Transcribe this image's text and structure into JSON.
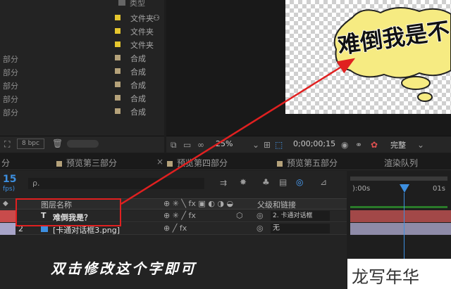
{
  "project_panel": {
    "header_partial": "类型",
    "rows": [
      {
        "name": "",
        "type": "文件夹",
        "color": "#e6c72e"
      },
      {
        "name": "",
        "type": "文件夹",
        "color": "#e6c72e"
      },
      {
        "name": "",
        "type": "文件夹",
        "color": "#e6c72e"
      },
      {
        "name": "部分",
        "type": "合成",
        "color": "#b5a27a"
      },
      {
        "name": "部分",
        "type": "合成",
        "color": "#b5a27a"
      },
      {
        "name": "部分",
        "type": "合成",
        "color": "#b5a27a"
      },
      {
        "name": "部分",
        "type": "合成",
        "color": "#b5a27a"
      },
      {
        "name": "部分",
        "type": "合成",
        "color": "#b5a27a"
      }
    ],
    "bpc_label": "8 bpc"
  },
  "composition": {
    "bubble_text": "难倒我是不",
    "zoom": "25%",
    "timecode": "0;00;00;15",
    "resolution": "完整"
  },
  "tabs": [
    {
      "label": "分",
      "color": ""
    },
    {
      "label": "预览第三部分",
      "color": "#b5a27a"
    },
    {
      "label": "预览第四部分",
      "color": "#b5a27a"
    },
    {
      "label": "预览第五部分",
      "color": "#b5a27a"
    },
    {
      "label": "渲染队列",
      "color": ""
    }
  ],
  "timeline": {
    "frame_counter": "15",
    "frame_sub": "fps)",
    "search_placeholder": "ρ.",
    "col_layer_name": "图层名称",
    "col_parent": "父级和链接",
    "ruler_start": "):00s",
    "ruler_end": "01s",
    "layers": [
      {
        "index": "",
        "type_icon": "T",
        "name": "难倒我是？",
        "parent": "2. 卡通对话框",
        "label_color": "#c84b4b"
      },
      {
        "index": "2",
        "type_icon": "img",
        "name": "[卡通对话框3.png]",
        "parent": "无",
        "label_color": "#a7a4c8"
      }
    ]
  },
  "annotation": {
    "caption": "双击修改这个字即可",
    "arrow_color": "#e02020",
    "highlight_color": "#e02020"
  },
  "watermark": "龙写年华"
}
